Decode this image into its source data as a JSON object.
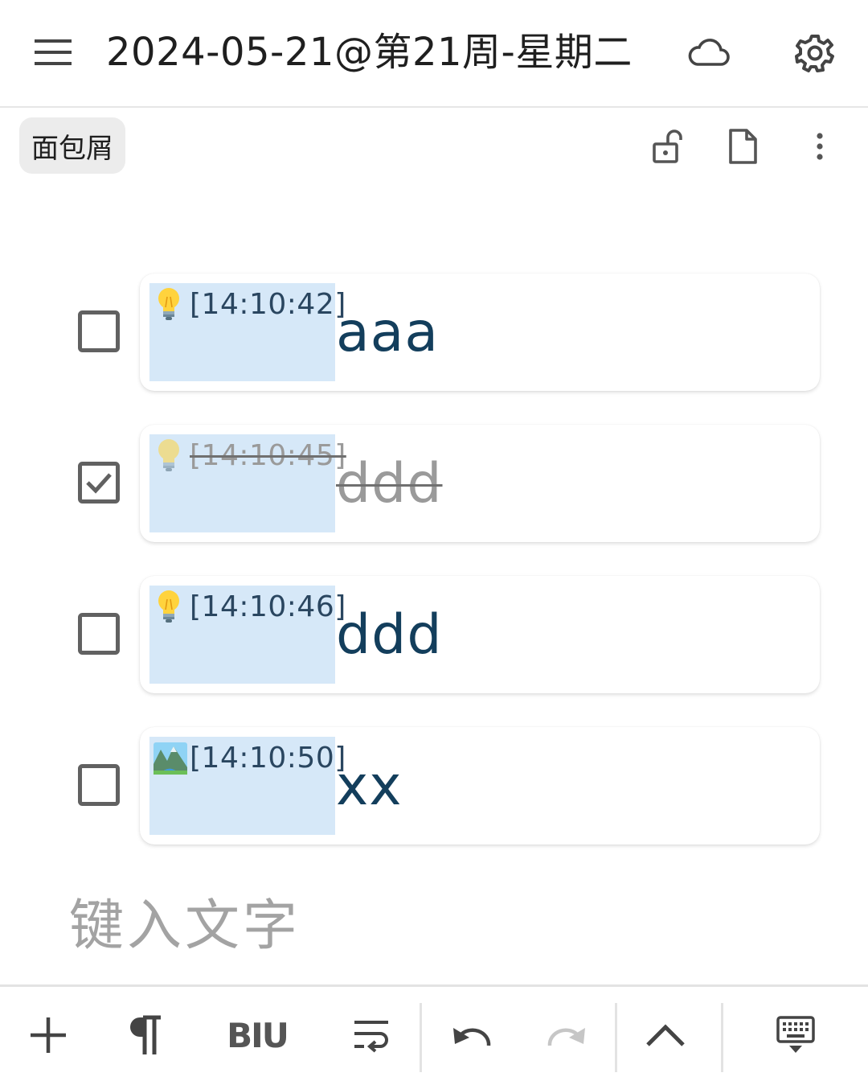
{
  "header": {
    "title": "2024-05-21@第21周-星期二",
    "icons": {
      "menu": "hamburger-icon",
      "sync": "cloud-icon",
      "settings": "gear-icon"
    }
  },
  "subbar": {
    "breadcrumb_label": "面包屑",
    "icons": [
      "unlock-icon",
      "document-icon",
      "more-vertical-icon"
    ]
  },
  "todos": [
    {
      "checked": false,
      "emoji": "lightbulb",
      "time": "[14:10:42]",
      "text": "aaa"
    },
    {
      "checked": true,
      "emoji": "lightbulb",
      "time": "[14:10:45]",
      "text": "ddd"
    },
    {
      "checked": false,
      "emoji": "lightbulb",
      "time": "[14:10:46]",
      "text": "ddd"
    },
    {
      "checked": false,
      "emoji": "landscape",
      "time": "[14:10:50]",
      "text": "xx"
    }
  ],
  "input": {
    "placeholder": "键入文字"
  },
  "toolbar": {
    "format_label": "BIU",
    "icons": [
      "plus-icon",
      "paragraph-icon",
      "text-format-icon",
      "wrap-icon",
      "undo-icon",
      "redo-icon",
      "chevron-up-icon",
      "keyboard-hide-icon"
    ]
  },
  "colors": {
    "timestamp_highlight": "#d6e8f8",
    "content_text": "#133e5c",
    "done_text": "#9a9a9a"
  }
}
